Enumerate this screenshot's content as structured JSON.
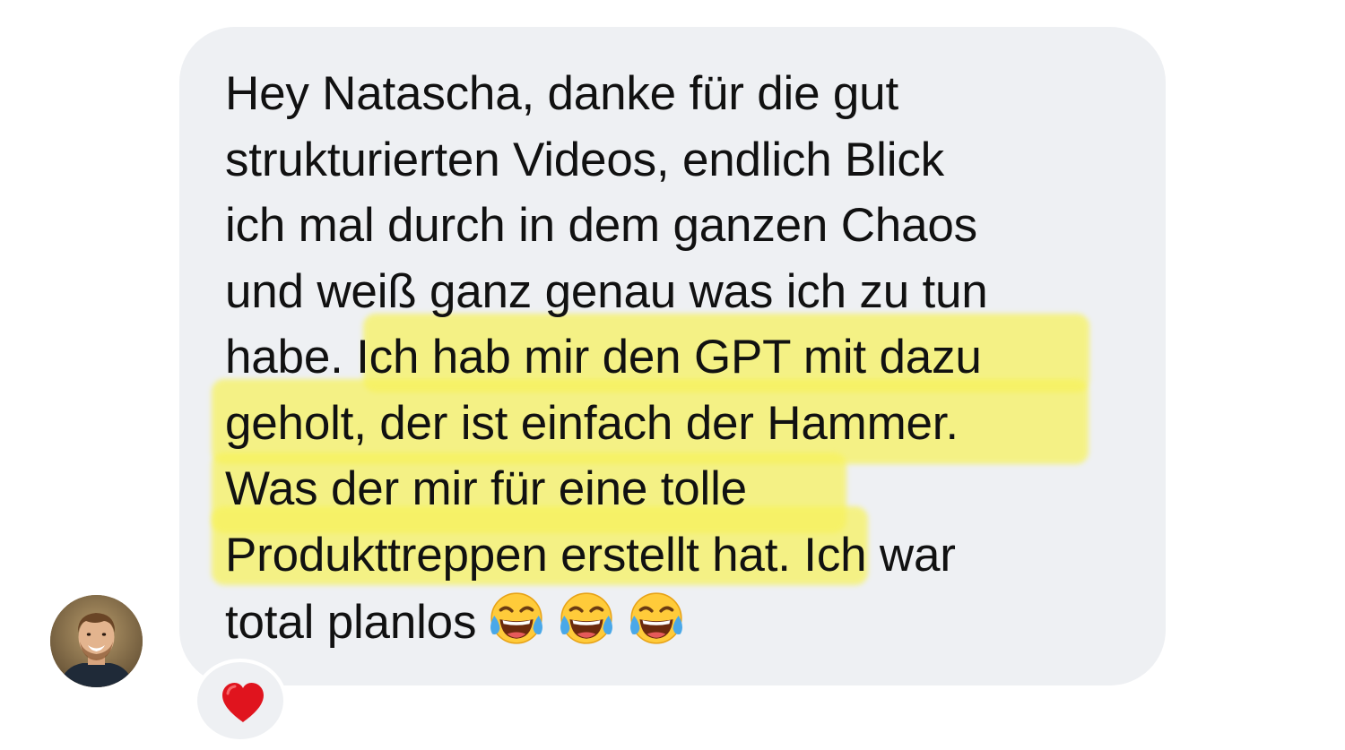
{
  "message": {
    "lines": [
      "Hey Natascha, danke für die gut",
      "strukturierten Videos, endlich Blick",
      "ich mal durch in dem ganzen Chaos",
      "und weiß ganz genau was ich zu tun",
      "habe. Ich hab mir den GPT mit dazu",
      "geholt, der ist einfach der Hammer.",
      "Was der mir für eine tolle",
      "Produkttreppen erstellt hat. Ich war",
      "total planlos"
    ],
    "emojis": [
      "face-with-tears-of-joy-icon",
      "face-with-tears-of-joy-icon",
      "face-with-tears-of-joy-icon"
    ],
    "bubble_color": "#eef0f3",
    "highlight_color": "#f7f25c",
    "text_color": "#111111"
  },
  "reaction": {
    "icon": "red-heart-icon",
    "color": "#e0141e"
  },
  "sender": {
    "avatar_icon": "avatar"
  }
}
